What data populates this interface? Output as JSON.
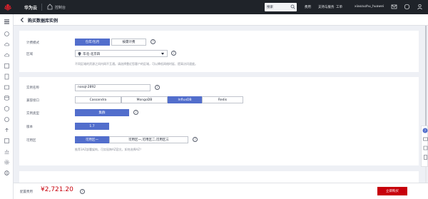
{
  "topbar": {
    "brand": "华为云",
    "console": "控制台",
    "search_placeholder": "搜索",
    "nav": [
      "服务",
      "费用",
      "资源",
      "工单",
      "备案",
      "支持与服务"
    ],
    "user": "xiaozuzhu_huawei",
    "icons": [
      "message-icon",
      "help-icon",
      "user-icon",
      "menu-icon"
    ]
  },
  "page": {
    "title": "购买数据库实例"
  },
  "billing": {
    "label": "计费模式",
    "options": [
      "包年/包月",
      "按需计费"
    ],
    "selected": "包年/包月"
  },
  "region": {
    "label": "区域",
    "value": "华北-北京四",
    "hint": "不同区域的资源之间内网不互通。请选择靠近您客户的区域，可以降低网络时延、提高访问速度。"
  },
  "instance": {
    "name_label": "实例名称",
    "name_value": "nosql-2892",
    "compat_label": "兼容接口",
    "compat_options": [
      "Cassandra",
      "MongoDB",
      "InfluxDB",
      "Redis"
    ],
    "compat_selected": "InfluxDB",
    "type_label": "实例类型",
    "type_value": "集群",
    "version_label": "版本",
    "version_value": "1.7",
    "az_label": "可用区",
    "az_options": [
      "可用区一",
      "可用区一,可用区二,可用区三"
    ],
    "az_selected": "可用区一",
    "az_hint": "推荐3AZ部署架构，可实现跨AZ容灾。如何选择AZ？"
  },
  "footer": {
    "price_label": "配置费用",
    "price": "¥2,721.20",
    "buy_label": "立即购买"
  },
  "colors": {
    "primary": "#526ecc",
    "buy": "#c7000b",
    "topbar": "#1f2329"
  }
}
